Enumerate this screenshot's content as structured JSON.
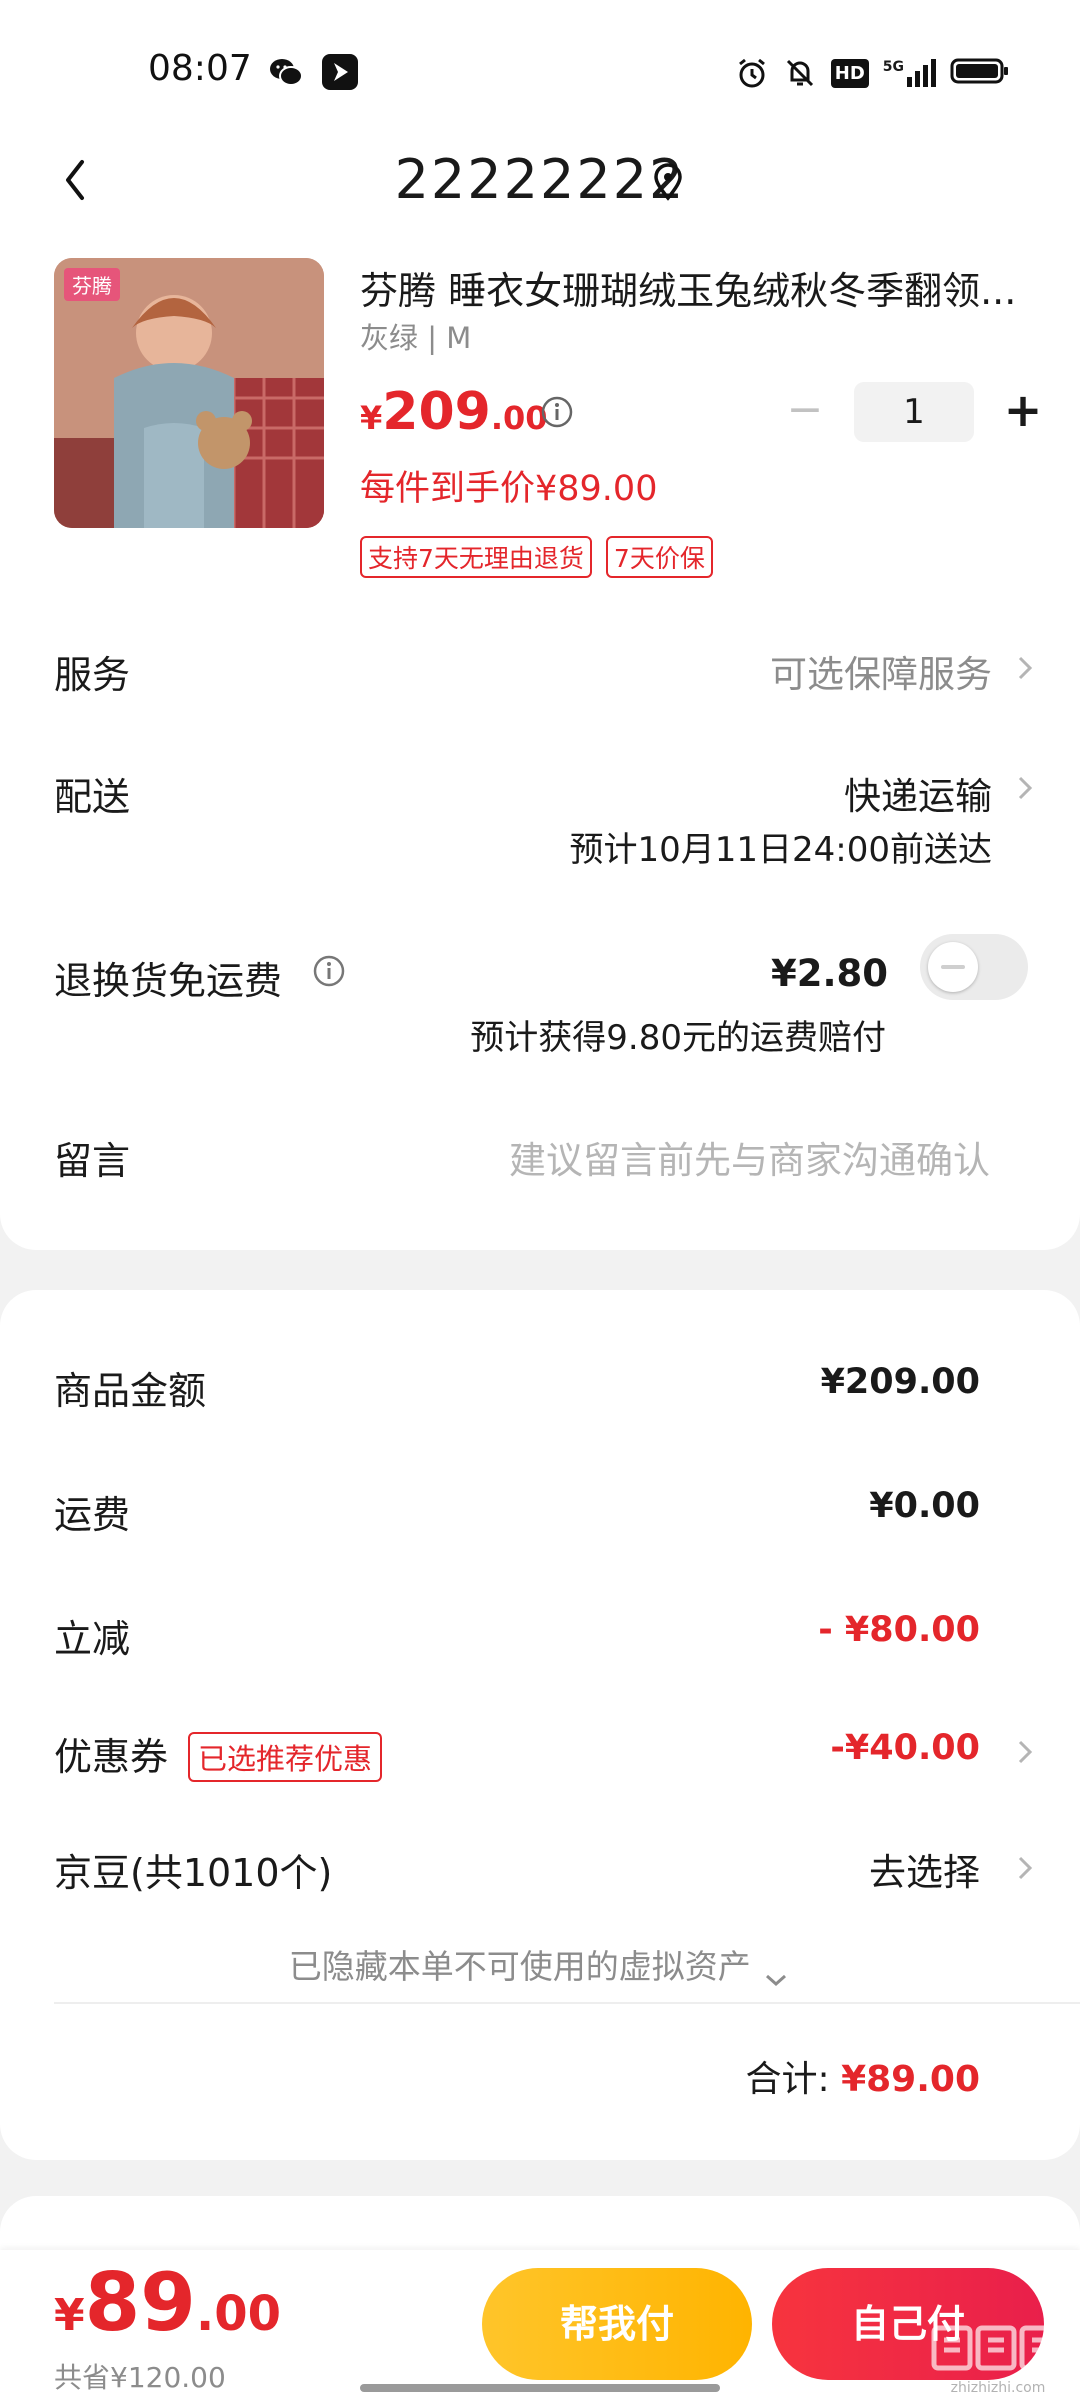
{
  "status_bar": {
    "time": "08:07",
    "left_icons": [
      "wechat-icon",
      "app-notification-icon"
    ],
    "right_icons": [
      "alarm-icon",
      "mute-bell-icon",
      "hd-icon",
      "5g-signal-icon",
      "battery-icon"
    ],
    "hd_label": "HD",
    "network_label": "5G"
  },
  "header": {
    "address": "22222222"
  },
  "product": {
    "title": "芬腾 睡衣女珊瑚绒玉兔绒秋冬季翻领...",
    "brand_logo_text": "芬腾",
    "spec": "灰绿 | M",
    "price_currency": "¥",
    "price_integer": "209",
    "price_decimal": ".00",
    "quantity": "1",
    "minus_label": "−",
    "plus_label": "+",
    "hand_price": "每件到手价¥89.00",
    "tags": [
      "支持7天无理由退货",
      "7天价保"
    ]
  },
  "order_options": {
    "service_label": "服务",
    "service_value": "可选保障服务",
    "delivery_label": "配送",
    "delivery_value": "快递运输",
    "delivery_eta": "预计10月11日24:00前送达",
    "return_label": "退换货免运费",
    "return_price": "¥2.80",
    "return_compensation": "预计获得9.80元的运费赔付",
    "return_toggle_on": false,
    "message_label": "留言",
    "message_placeholder": "建议留言前先与商家沟通确认"
  },
  "summary": {
    "goods_amount_label": "商品金额",
    "goods_amount_value": "¥209.00",
    "shipping_label": "运费",
    "shipping_value": "¥0.00",
    "discount_label": "立减",
    "discount_value": "- ¥80.00",
    "coupon_label": "优惠券",
    "coupon_badge": "已选推荐优惠",
    "coupon_value": "-¥40.00",
    "jingdou_label": "京豆(共1010个)",
    "jingdou_value": "去选择",
    "hidden_assets": "已隐藏本单不可使用的虚拟资产",
    "total_label": "合计:",
    "total_value": "¥89.00"
  },
  "bottom_bar": {
    "pay_currency": "¥",
    "pay_integer": "89",
    "pay_decimal": ".00",
    "saved": "共省¥120.00",
    "help_pay_label": "帮我付",
    "self_pay_label": "自己付"
  },
  "watermark": "值 什么值得买",
  "colors": {
    "accent_red": "#e4262b",
    "help_button": "#ffb400",
    "self_button": "#ef2845",
    "muted_text": "#8c8c8c",
    "page_bg": "#f2f2f2"
  }
}
